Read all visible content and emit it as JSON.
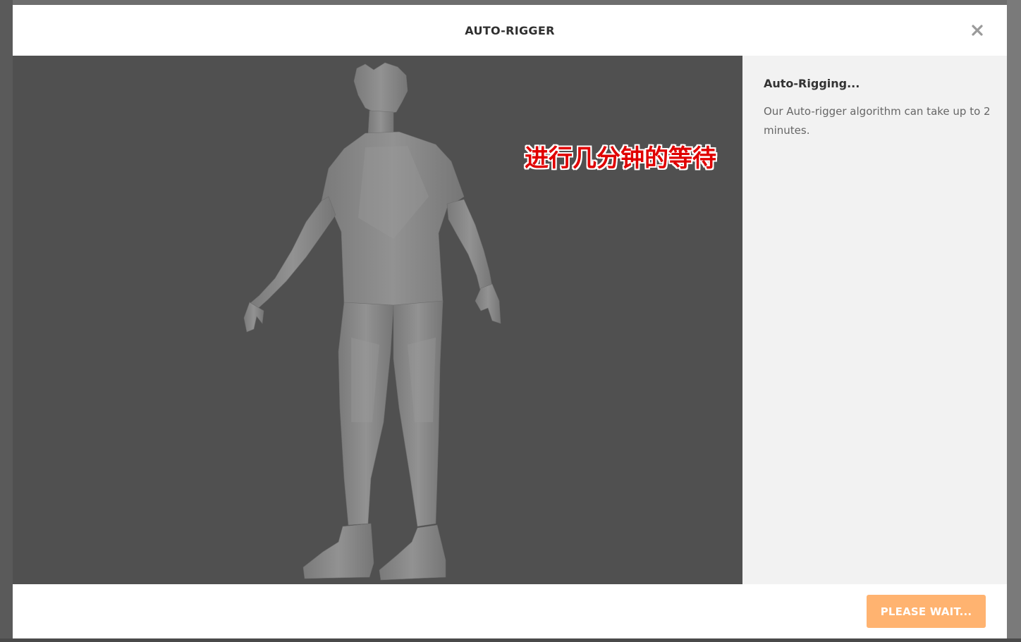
{
  "dialog": {
    "title": "AUTO-RIGGER",
    "close_icon": "close-icon"
  },
  "viewport": {
    "caption": "进行几分钟的等待",
    "background_color": "#505050",
    "model_color": "#8a8a8a"
  },
  "side_panel": {
    "title": "Auto-Rigging...",
    "description": "Our Auto-rigger algorithm can take up to 2 minutes."
  },
  "footer": {
    "wait_button_label": "PLEASE WAIT...",
    "wait_button_color": "#ffb370"
  }
}
